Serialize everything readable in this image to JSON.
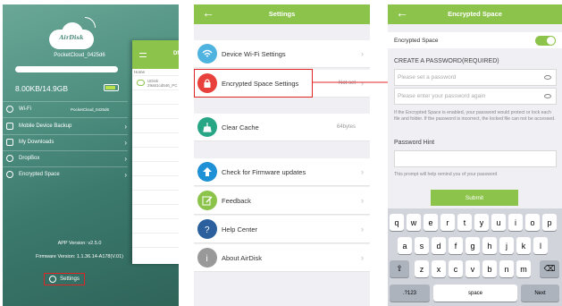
{
  "panel1": {
    "logo_text": "AirDisk",
    "device_name": "PocketCloud_0425d6",
    "storage": "8.00KB/14.9GB",
    "menu": [
      {
        "label": "Wi-Fi",
        "value": "PocketCloud_0425d6",
        "icon": "wifi-icon"
      },
      {
        "label": "Mobile Device Backup",
        "value": "",
        "icon": "backup-icon"
      },
      {
        "label": "My Downloads",
        "value": "",
        "icon": "download-icon"
      },
      {
        "label": "DropBox",
        "value": "",
        "icon": "dropbox-icon"
      },
      {
        "label": "Encrypted Space",
        "value": "",
        "icon": "lock-icon"
      }
    ],
    "app_version": "APP Version: v2.5.0",
    "firmware_version": "Firmware Version: 1.1.36.14-A178(V.01)",
    "settings_label": "Settings",
    "overlay": {
      "header": "DN",
      "home": "Home",
      "item": "UDisk",
      "item_sub": "29a51cd546_PC"
    }
  },
  "panel2": {
    "title": "Settings",
    "rows": [
      {
        "label": "Device Wi-Fi Settings",
        "value": "",
        "icon": "wifi-icon",
        "color": "#4fb3e0"
      },
      {
        "label": "Encrypted Space Settings",
        "value": "Not set",
        "icon": "lock-icon",
        "color": "#e8413b"
      },
      {
        "label": "Clear Cache",
        "value": "64bytes",
        "icon": "broom-icon",
        "color": "#27a685"
      },
      {
        "label": "Check for Firmware updates",
        "value": "",
        "icon": "upload-icon",
        "color": "#1e90d6"
      },
      {
        "label": "Feedback",
        "value": "",
        "icon": "edit-icon",
        "color": "#8cc34a"
      },
      {
        "label": "Help Center",
        "value": "",
        "icon": "help-icon",
        "color": "#2b5f9e"
      },
      {
        "label": "About AirDisk",
        "value": "",
        "icon": "info-icon",
        "color": "#999999"
      }
    ]
  },
  "panel3": {
    "title": "Encrypted Space",
    "toggle_label": "Encrypted Space",
    "toggle_on": true,
    "section": "CREATE A PASSWORD(REQUIRED)",
    "password_placeholder": "Please set a password",
    "confirm_placeholder": "Please enter your password again",
    "note": "If the Encrypted Space is enabled, your password would protect or lock each file and folder. If the password is incorrect, the locked file can not be accessed.",
    "hint_label": "Password Hint",
    "hint_note": "This prompt will help remind you of your password",
    "submit": "Submit",
    "keyboard": {
      "row1": [
        "q",
        "w",
        "e",
        "r",
        "t",
        "y",
        "u",
        "i",
        "o",
        "p"
      ],
      "row2": [
        "a",
        "s",
        "d",
        "f",
        "g",
        "h",
        "j",
        "k",
        "l"
      ],
      "row3": [
        "z",
        "x",
        "c",
        "v",
        "b",
        "n",
        "m"
      ],
      "numbers": ".?123",
      "space": "space",
      "next": "Next"
    }
  }
}
